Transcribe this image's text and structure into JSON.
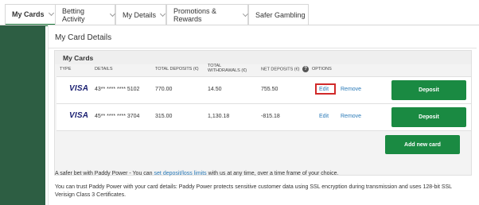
{
  "tabs": [
    {
      "label": "My Cards"
    },
    {
      "label": "Betting Activity"
    },
    {
      "label": "My Details"
    },
    {
      "label": "Promotions & Rewards"
    },
    {
      "label": "Safer Gambling"
    }
  ],
  "panel": {
    "title": "My Card Details",
    "section_title": "My Cards"
  },
  "columns": {
    "type": "TYPE",
    "details": "DETAILS",
    "total_deposits": "TOTAL DEPOSITS (€)",
    "total_withdrawals_1": "TOTAL",
    "total_withdrawals_2": "WITHDRAWALS (€)",
    "net_deposits": "NET DEPOSITS (€)",
    "options": "OPTIONS",
    "info_icon": "?"
  },
  "cards": [
    {
      "type": "VISA",
      "details": "43** **** **** 5102",
      "total_deposits": "770.00",
      "total_withdrawals": "14.50",
      "net_deposits": "755.50",
      "edit": "Edit",
      "remove": "Remove",
      "deposit": "Deposit"
    },
    {
      "type": "VISA",
      "details": "45** **** **** 3704",
      "total_deposits": "315.00",
      "total_withdrawals": "1,130.18",
      "net_deposits": "-815.18",
      "edit": "Edit",
      "remove": "Remove",
      "deposit": "Deposit"
    }
  ],
  "add_card": "Add new card",
  "footer": {
    "line1_pre": "A safer bet with Paddy Power - You can ",
    "line1_link": "set deposit/loss limits",
    "line1_post": " with us at any time, over a time frame of your choice.",
    "line2": "You can trust Paddy Power with your card details: Paddy Power protects sensitive customer data using SSL encryption during transmission and uses 128-bit SSL Verisign Class 3 Certificates."
  },
  "colors": {
    "accent_green": "#1a8a42",
    "sidebar_green": "#2d5e43",
    "link_blue": "#2a7ab8",
    "highlight_red": "#d12a2a"
  }
}
